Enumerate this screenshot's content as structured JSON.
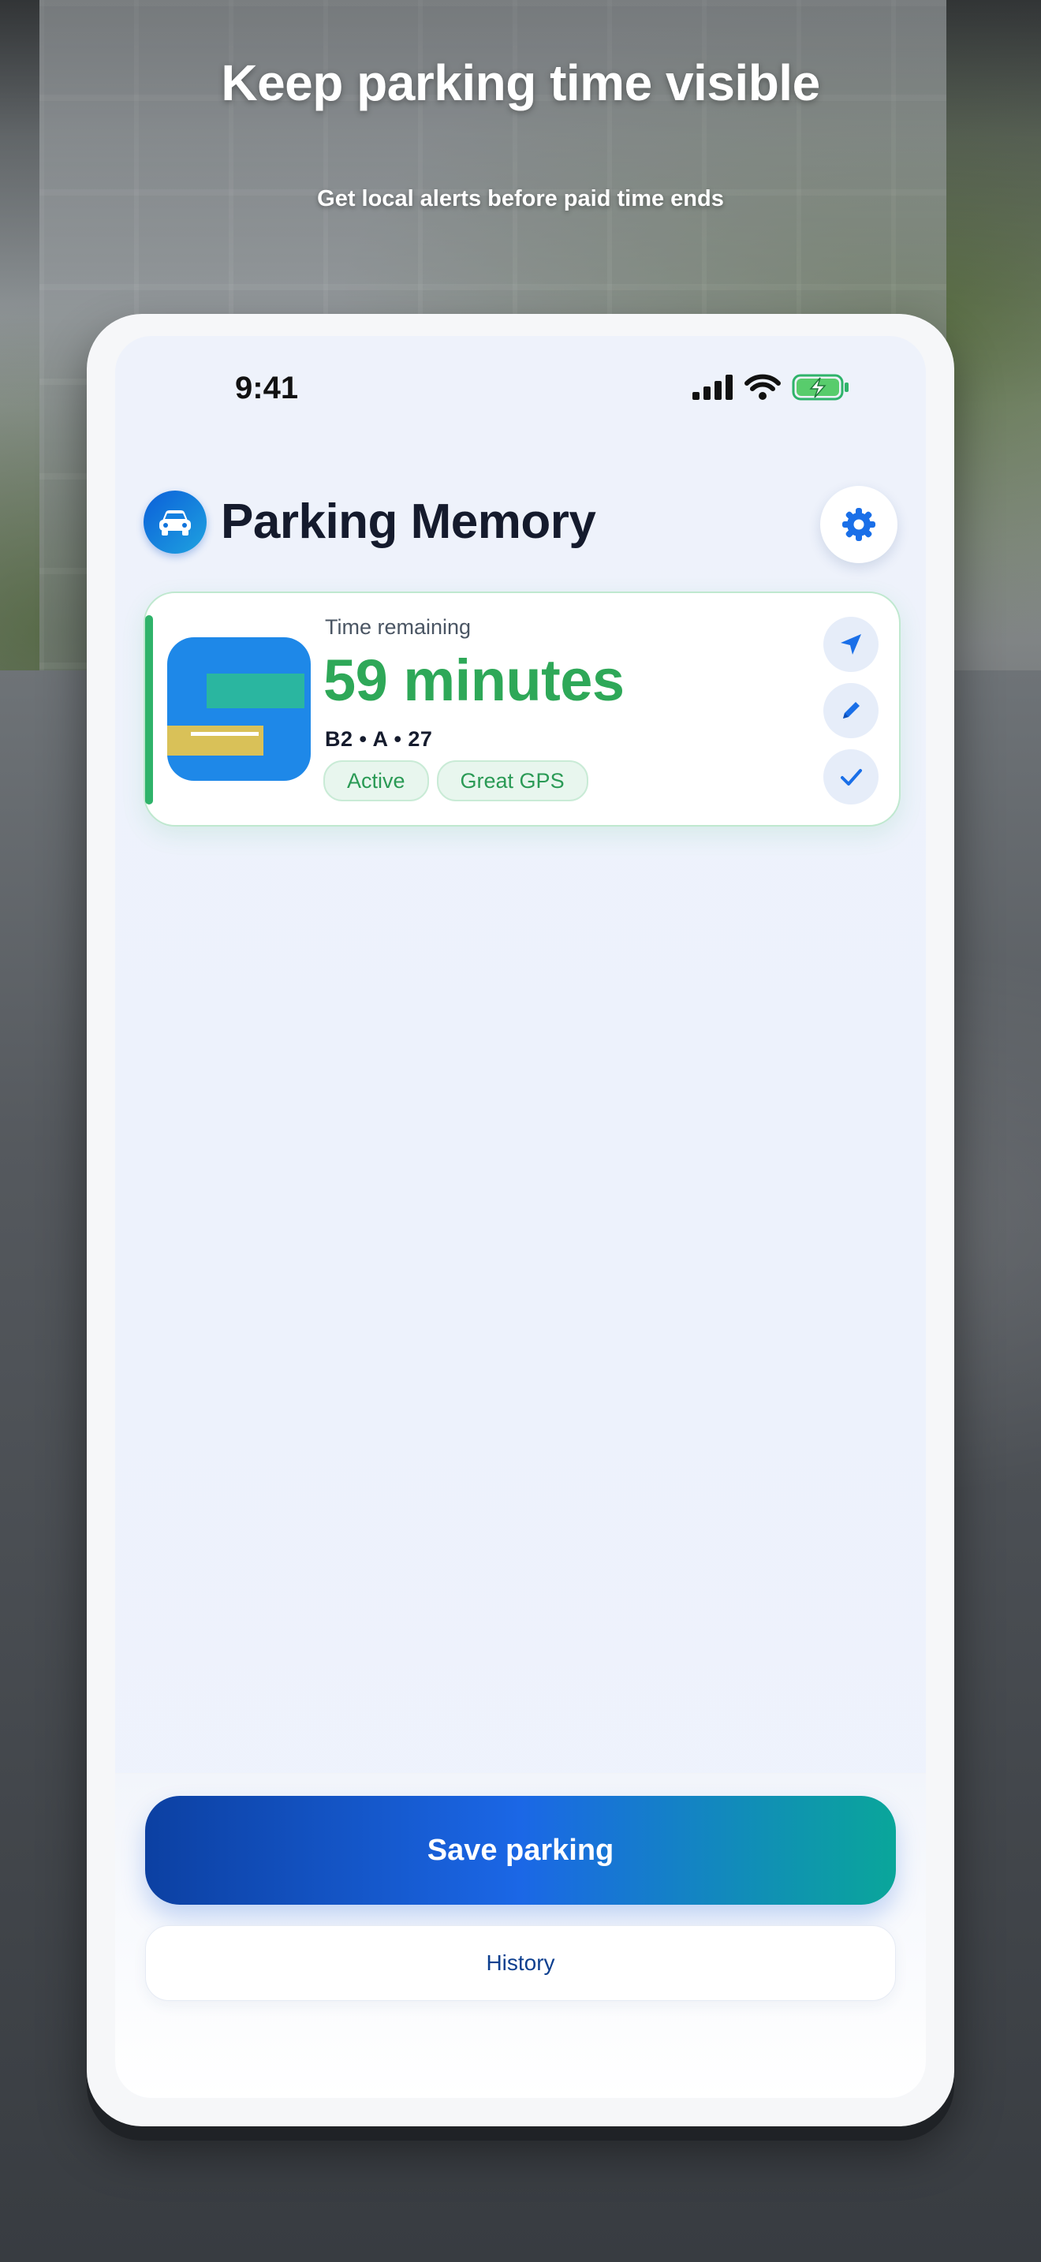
{
  "promo": {
    "headline": "Keep parking time visible",
    "subline": "Get local alerts before paid time ends"
  },
  "status_bar": {
    "time": "9:41"
  },
  "app": {
    "title": "Parking Memory"
  },
  "parking_card": {
    "label": "Time remaining",
    "remaining": "59 minutes",
    "spot": "B2 • A • 27",
    "chips": [
      "Active",
      "Great GPS"
    ],
    "accent_color": "#2fb36a",
    "remaining_color": "#2ea858"
  },
  "footer": {
    "save_label": "Save parking",
    "history_label": "History"
  },
  "icons": {
    "app_logo": "car-icon",
    "settings": "gear-icon",
    "actions": [
      "navigation-arrow-icon",
      "pencil-icon",
      "checkmark-icon"
    ]
  }
}
